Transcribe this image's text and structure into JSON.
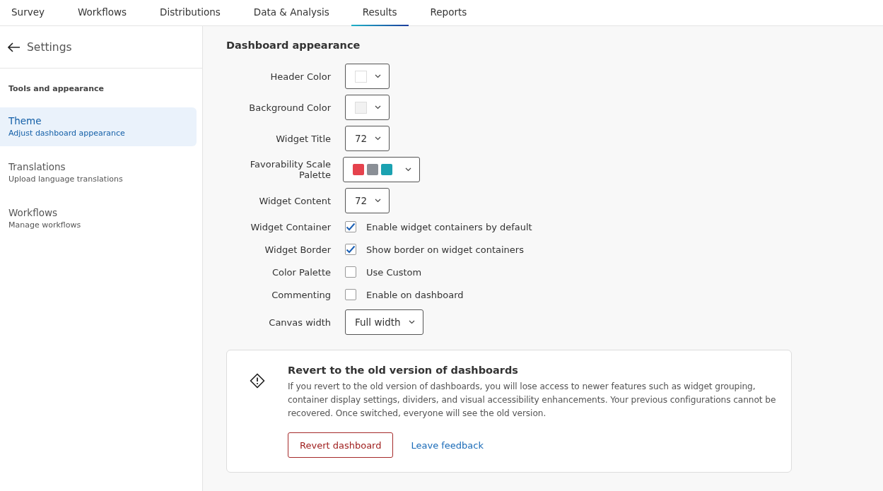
{
  "tabs": [
    {
      "label": "Survey",
      "selected": false
    },
    {
      "label": "Workflows",
      "selected": false
    },
    {
      "label": "Distributions",
      "selected": false
    },
    {
      "label": "Data & Analysis",
      "selected": false
    },
    {
      "label": "Results",
      "selected": true
    },
    {
      "label": "Reports",
      "selected": false
    }
  ],
  "sidebar": {
    "back_label": "Settings",
    "section": "Tools and appearance",
    "items": [
      {
        "title": "Theme",
        "subtitle": "Adjust dashboard appearance",
        "selected": true
      },
      {
        "title": "Translations",
        "subtitle": "Upload language translations",
        "selected": false
      },
      {
        "title": "Workflows",
        "subtitle": "Manage workflows",
        "selected": false
      }
    ]
  },
  "main": {
    "heading": "Dashboard appearance",
    "settings": [
      {
        "kind": "color",
        "label": "Header Color",
        "color": "#ffffff"
      },
      {
        "kind": "color",
        "label": "Background Color",
        "color": "#f2f2f2"
      },
      {
        "kind": "select",
        "label": "Widget Title",
        "value": "72"
      },
      {
        "kind": "palette",
        "label": "Favorability Scale Palette",
        "swatches": [
          {
            "color": "#e5424d"
          },
          {
            "color": "#8a8f96"
          },
          {
            "color": "#1ba2b1"
          }
        ]
      },
      {
        "kind": "select",
        "label": "Widget Content",
        "value": "72"
      },
      {
        "kind": "checkbox",
        "label": "Widget Container",
        "text": "Enable widget containers by default",
        "checked": true
      },
      {
        "kind": "checkbox",
        "label": "Widget Border",
        "text": "Show border on widget containers",
        "checked": true
      },
      {
        "kind": "checkbox",
        "label": "Color Palette",
        "text": "Use Custom",
        "checked": false
      },
      {
        "kind": "checkbox",
        "label": "Commenting",
        "text": "Enable on dashboard",
        "checked": false
      },
      {
        "kind": "select",
        "label": "Canvas width",
        "value": "Full width"
      }
    ],
    "notice": {
      "title": "Revert to the old version of dashboards",
      "body": "If you revert to the old version of dashboards, you will lose access to newer features such as widget grouping, container display settings, dividers, and visual accessibility enhancements. Your previous configurations cannot be recovered. Once switched, everyone will see the old version.",
      "button": "Revert dashboard",
      "link": "Leave feedback"
    }
  }
}
